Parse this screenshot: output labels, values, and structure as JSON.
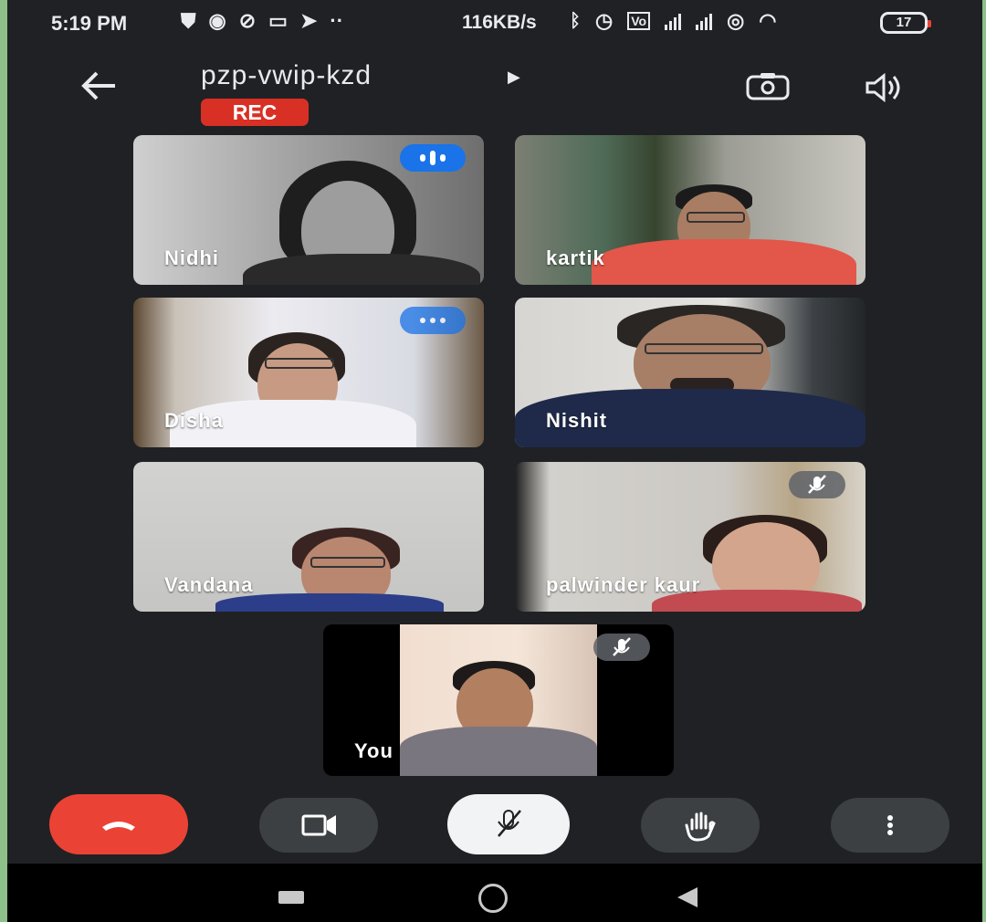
{
  "status_bar": {
    "time": "5:19 PM",
    "net_speed": "116KB/s",
    "battery": "17",
    "icons": [
      "shield-icon",
      "chat-icon",
      "link-icon",
      "video-icon",
      "telegram-icon",
      "more-dots-icon",
      "bluetooth-icon",
      "alarm-icon",
      "volte-icon",
      "signal-icon",
      "signal-icon",
      "hotspot-icon",
      "wifi-icon",
      "battery-icon"
    ]
  },
  "header": {
    "meeting_code": "pzp-vwip-kzd",
    "rec_label": "REC"
  },
  "participants": [
    {
      "name": "Nidhi",
      "speaking": true,
      "muted": false
    },
    {
      "name": "kartik",
      "speaking": false,
      "muted": false
    },
    {
      "name": "Disha",
      "speaking": true,
      "muted": false
    },
    {
      "name": "Nishit",
      "speaking": false,
      "muted": false
    },
    {
      "name": "Vandana",
      "speaking": false,
      "muted": false
    },
    {
      "name": "palwinder kaur",
      "speaking": false,
      "muted": true
    }
  ],
  "self_view": {
    "name": "You",
    "muted": true
  },
  "controls": [
    "end-call-icon",
    "video-camera-icon",
    "mic-off-icon",
    "raise-hand-icon",
    "more-vertical-icon"
  ],
  "colors": {
    "end_call": "#ea4335",
    "rec": "#d93025",
    "speaking": "#1a73e8",
    "background": "#202124"
  }
}
